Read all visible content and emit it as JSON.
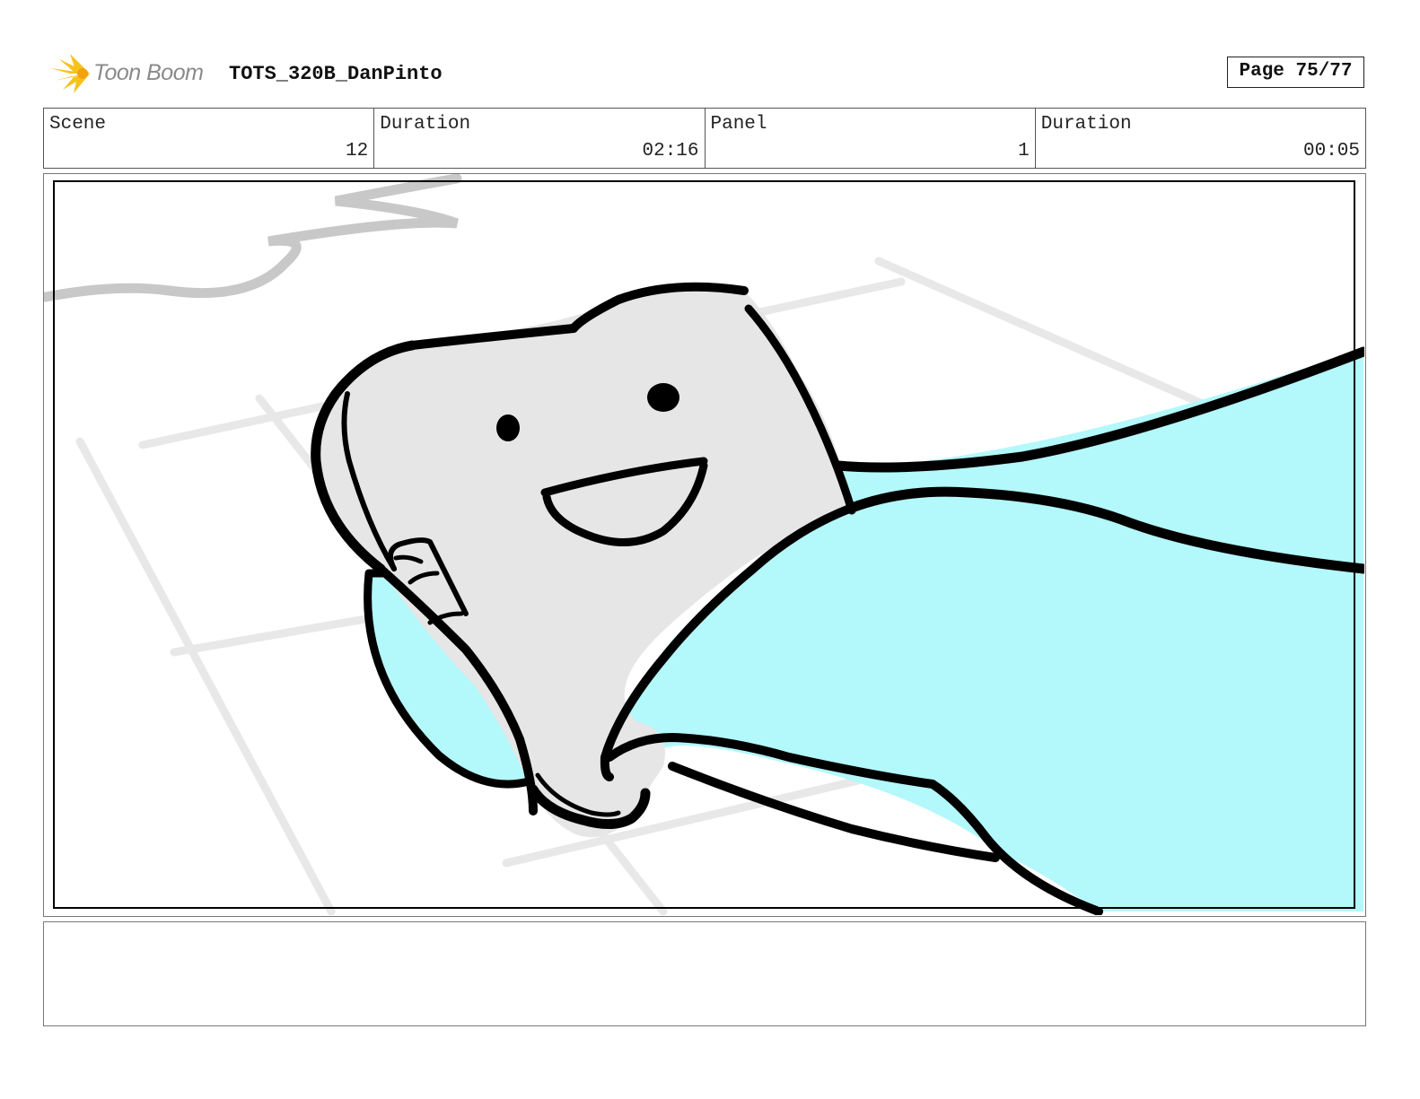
{
  "header": {
    "logo_text": "Toon Boom",
    "project_title": "TOTS_320B_DanPinto",
    "page_label": "Page 75/77"
  },
  "info": {
    "scene_label": "Scene",
    "scene_value": "12",
    "scene_duration_label": "Duration",
    "scene_duration_value": "02:16",
    "panel_label": "Panel",
    "panel_value": "1",
    "panel_duration_label": "Duration",
    "panel_duration_value": "00:05"
  },
  "panel": {
    "colors": {
      "fill": "#b3f8fb",
      "tooth": "#e6e6e6",
      "line": "#000000",
      "guide": "#e8e8e8"
    }
  },
  "caption": {
    "text": ""
  }
}
